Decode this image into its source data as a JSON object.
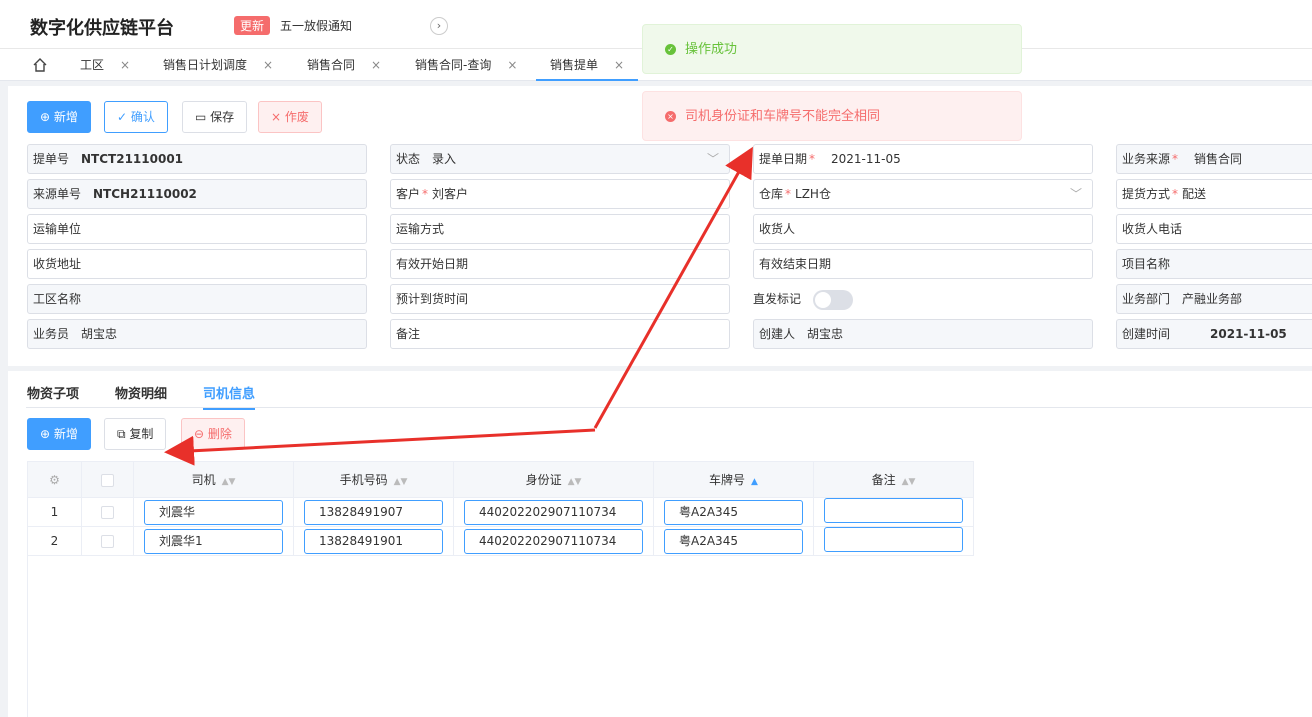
{
  "app": {
    "title": "数字化供应链平台",
    "badge": "更新",
    "notice": "五一放假通知"
  },
  "tabs": [
    {
      "label": "工区"
    },
    {
      "label": "销售日计划调度"
    },
    {
      "label": "销售合同"
    },
    {
      "label": "销售合同-查询"
    },
    {
      "label": "销售提单"
    }
  ],
  "toolbar": {
    "add": "新增",
    "confirm": "确认",
    "save": "保存",
    "void": "作废"
  },
  "form": {
    "bill_no": {
      "label": "提单号",
      "value": "NTCT21110001"
    },
    "status": {
      "label": "状态",
      "value": "录入"
    },
    "bill_date": {
      "label": "提单日期",
      "value": "2021-11-05"
    },
    "biz_source": {
      "label": "业务来源",
      "value": "销售合同"
    },
    "source_no": {
      "label": "来源单号",
      "value": "NTCH21110002"
    },
    "customer": {
      "label": "客户",
      "value": "刘客户"
    },
    "warehouse": {
      "label": "仓库",
      "value": "LZH仓"
    },
    "pickup": {
      "label": "提货方式",
      "value": "配送"
    },
    "carrier": {
      "label": "运输单位"
    },
    "transport": {
      "label": "运输方式"
    },
    "receiver": {
      "label": "收货人"
    },
    "receiver_phone": {
      "label": "收货人电话"
    },
    "address": {
      "label": "收货地址"
    },
    "valid_start": {
      "label": "有效开始日期"
    },
    "valid_end": {
      "label": "有效结束日期"
    },
    "project": {
      "label": "项目名称"
    },
    "work_area": {
      "label": "工区名称"
    },
    "arrival": {
      "label": "预计到货时间"
    },
    "direct": {
      "label": "直发标记"
    },
    "dept": {
      "label": "业务部门",
      "value": "产融业务部"
    },
    "salesman": {
      "label": "业务员",
      "value": "胡宝忠"
    },
    "remark": {
      "label": "备注"
    },
    "creator": {
      "label": "创建人",
      "value": "胡宝忠"
    },
    "created_at": {
      "label": "创建时间",
      "value": "2021-11-05"
    }
  },
  "subtabs": [
    "物资子项",
    "物资明细",
    "司机信息"
  ],
  "detail_toolbar": {
    "add": "新增",
    "copy": "复制",
    "delete": "删除"
  },
  "table": {
    "headers": [
      "司机",
      "手机号码",
      "身份证",
      "车牌号",
      "备注"
    ],
    "rows": [
      {
        "index": "1",
        "driver": "刘震华",
        "phone": "13828491907",
        "id_card": "440202202907110734",
        "plate": "粤A2A345",
        "remark": ""
      },
      {
        "index": "2",
        "driver": "刘震华1",
        "phone": "13828491901",
        "id_card": "440202202907110734",
        "plate": "粤A2A345",
        "remark": ""
      }
    ]
  },
  "toasts": {
    "success": "操作成功",
    "error": "司机身份证和车牌号不能完全相同"
  },
  "colors": {
    "primary": "#409eff",
    "danger": "#f56c6c",
    "success": "#67c23a",
    "annotation": "#e8302a"
  }
}
